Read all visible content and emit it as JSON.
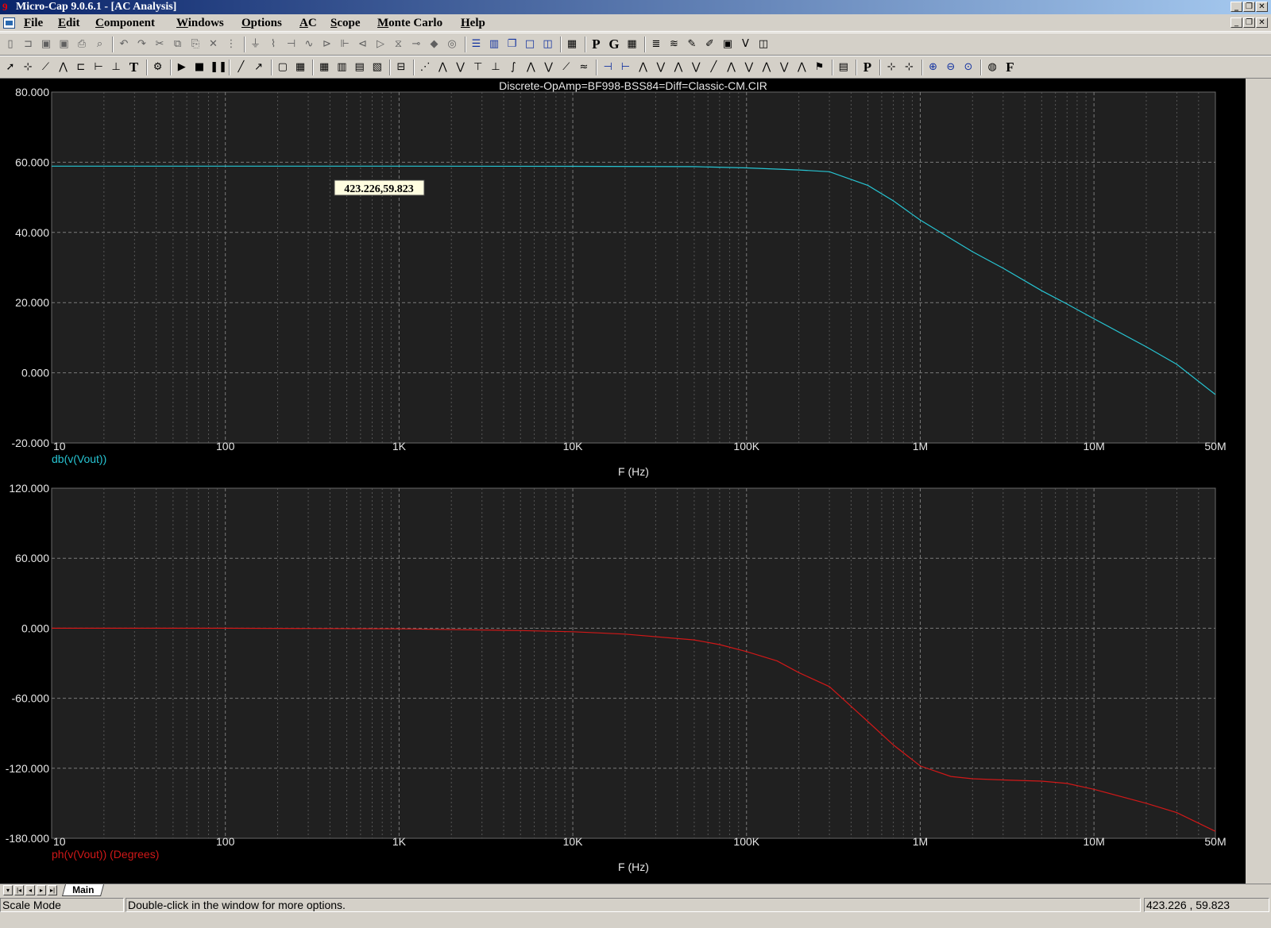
{
  "window": {
    "title": "Micro-Cap 9.0.6.1 - [AC Analysis]"
  },
  "menu": {
    "items": [
      "File",
      "Edit",
      "Component",
      "Windows",
      "Options",
      "AC",
      "Scope",
      "Monte Carlo",
      "Help"
    ]
  },
  "toolbar1": {
    "icons": [
      "new-file-icon",
      "open-icon",
      "save-icon",
      "save-all-icon",
      "print-icon",
      "print-preview-icon",
      "undo-icon",
      "redo-icon",
      "cut-icon",
      "copy-icon",
      "paste-icon",
      "clear-icon",
      "select-all-icon",
      "ground-icon",
      "resistor-icon",
      "capacitor-icon",
      "inductor-icon",
      "diode-icon",
      "battery-icon",
      "transistor-icon",
      "opamp-icon",
      "transformer-icon",
      "switch-icon",
      "node-icon",
      "vsource-icon",
      "tile-horizontal-icon",
      "tile-vertical-icon",
      "cascade-icon",
      "window-icon",
      "window-split-icon",
      "calculator-icon",
      "p-icon",
      "g-icon",
      "grid-icon",
      "component-list-icon",
      "waveform-icon",
      "probe-icon",
      "pen-icon",
      "text-box-icon",
      "vd-icon",
      "info-icon"
    ]
  },
  "toolbar2": {
    "icons": [
      "select-arrow-icon",
      "pointer-scale-icon",
      "scale-mode-icon",
      "cursor-mode-icon",
      "point-tag-icon",
      "horizontal-tag-icon",
      "vertical-tag-icon",
      "text-icon",
      "properties-icon",
      "run-icon",
      "stop-icon",
      "pause-icon",
      "line-icon",
      "arrow-line-icon",
      "rectangle-icon",
      "grid-icon",
      "minor-grid-icon",
      "major-grid-icon",
      "table-icon",
      "hatch-icon",
      "legend-icon",
      "data-points-icon",
      "peak-icon",
      "valley-icon",
      "high-icon",
      "low-icon",
      "inflection-icon",
      "global-high-icon",
      "global-low-icon",
      "slope-icon",
      "animate-icon",
      "cursor-left-icon",
      "cursor-right-icon",
      "peak-cursor-icon",
      "valley-cursor-icon",
      "rise-icon",
      "fall-icon",
      "slope-cursor-icon",
      "next-point-icon",
      "prev-point-icon",
      "go-to-x-icon",
      "go-to-y-icon",
      "go-to-performance-icon",
      "flag-icon",
      "numeric-output-icon",
      "p-label-icon",
      "tracker-icon",
      "tracker-intercept-icon",
      "zoom-in-icon",
      "zoom-out-icon",
      "zoom-fit-icon",
      "globe-icon",
      "f-icon"
    ]
  },
  "plot": {
    "title": "Discrete-OpAmp=BF998-BSS84=Diff=Classic-CM.CIR",
    "tag_label": "423.226,59.823"
  },
  "chart_data": [
    {
      "type": "line",
      "xscale": "log",
      "xlim": [
        10,
        50000000
      ],
      "ylim": [
        -20,
        80
      ],
      "xlabel": "F (Hz)",
      "ylabel": "",
      "grid": true,
      "x_tick_labels": [
        "10",
        "100",
        "1K",
        "10K",
        "100K",
        "1M",
        "10M",
        "50M"
      ],
      "x_ticks": [
        10,
        100,
        1000,
        10000,
        100000,
        1000000,
        10000000,
        50000000
      ],
      "y_tick_labels": [
        "80.000",
        "60.000",
        "40.000",
        "20.000",
        "0.000",
        "-20.000"
      ],
      "y_ticks": [
        80,
        60,
        40,
        20,
        0,
        -20
      ],
      "series": [
        {
          "name": "db(v(Vout))",
          "color": "#27c4d2",
          "x": [
            10,
            100,
            1000,
            10000,
            50000,
            100000,
            200000,
            300000,
            500000,
            700000,
            1000000,
            2000000,
            3000000,
            5000000,
            7000000,
            10000000,
            20000000,
            30000000,
            50000000
          ],
          "y": [
            58.9,
            58.9,
            58.9,
            58.85,
            58.75,
            58.4,
            57.8,
            57.3,
            53.4,
            49.0,
            43.5,
            34.5,
            29.8,
            23.4,
            19.6,
            15.4,
            7.4,
            2.4,
            -6.2
          ]
        }
      ]
    },
    {
      "type": "line",
      "xscale": "log",
      "xlim": [
        10,
        50000000
      ],
      "ylim": [
        -180,
        120
      ],
      "xlabel": "F (Hz)",
      "ylabel": "",
      "grid": true,
      "x_tick_labels": [
        "10",
        "100",
        "1K",
        "10K",
        "100K",
        "1M",
        "10M",
        "50M"
      ],
      "x_ticks": [
        10,
        100,
        1000,
        10000,
        100000,
        1000000,
        10000000,
        50000000
      ],
      "y_tick_labels": [
        "120.000",
        "60.000",
        "0.000",
        "-60.000",
        "-120.000",
        "-180.000"
      ],
      "y_ticks": [
        120,
        60,
        0,
        -60,
        -120,
        -180
      ],
      "series": [
        {
          "name": "ph(v(Vout)) (Degrees)",
          "color": "#d01818",
          "x": [
            10,
            100,
            1000,
            5000,
            10000,
            20000,
            50000,
            70000,
            100000,
            150000,
            200000,
            300000,
            500000,
            700000,
            1000000,
            1500000,
            2000000,
            3000000,
            5000000,
            7000000,
            10000000,
            20000000,
            30000000,
            50000000
          ],
          "y": [
            0,
            0,
            -0.5,
            -2,
            -3,
            -5,
            -10,
            -14,
            -20,
            -28,
            -38,
            -50,
            -80,
            -100,
            -118,
            -127,
            -129,
            -130,
            -131,
            -133,
            -138,
            -150,
            -158,
            -174
          ]
        }
      ]
    }
  ],
  "tabs": {
    "nav": [
      "▾",
      "|◂",
      "◂",
      "▸",
      "▸|"
    ],
    "active": "Main"
  },
  "status": {
    "mode": "Scale Mode",
    "message": "Double-click in the window for more options.",
    "coords": "423.226 , 59.823"
  }
}
